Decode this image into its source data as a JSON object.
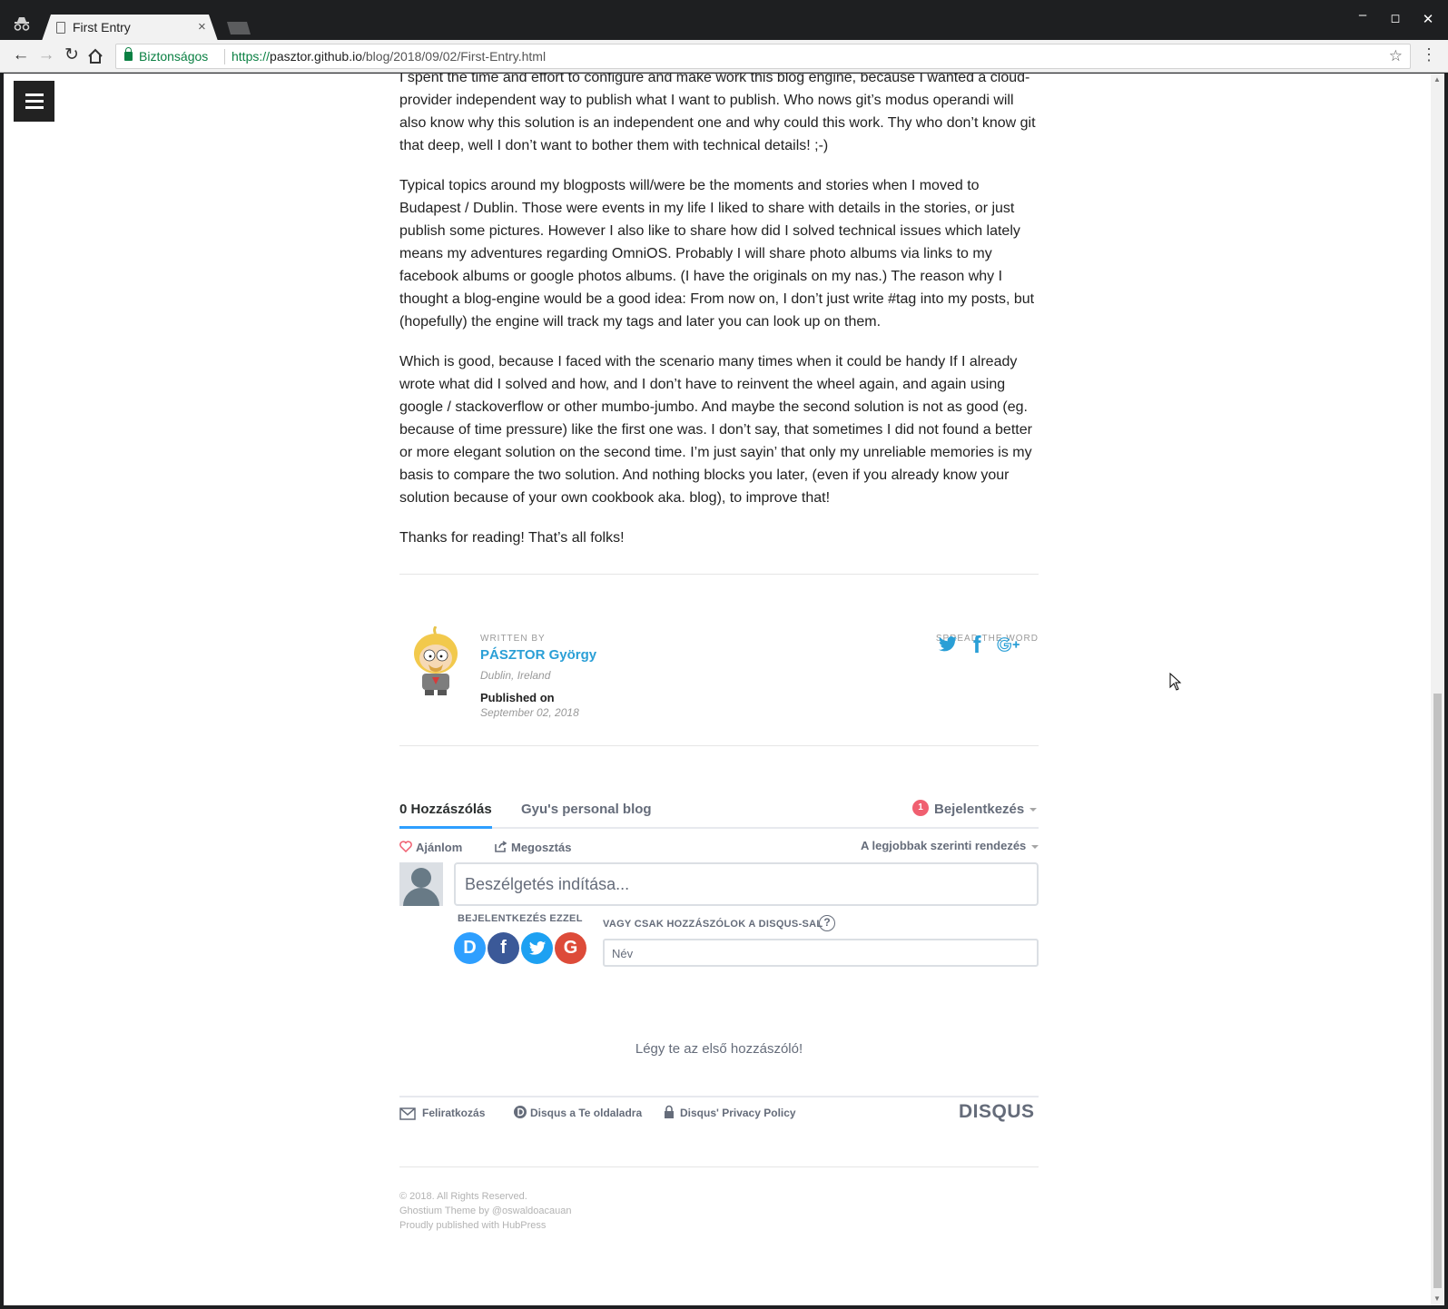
{
  "browser": {
    "tab_title": "First Entry",
    "tab_close": "×",
    "secure_label": "Biztonságos",
    "url_scheme": "https://",
    "url_host": "pasztor.github.io",
    "url_path": "/blog/2018/09/02/First-Entry.html"
  },
  "article": {
    "paragraphs": [
      "I spent the time and effort to configure and make work this blog engine, because I wanted a cloud-provider independent way to publish what I want to publish. Who nows git’s modus operandi will also know why this solution is an independent one and why could this work. Thy who don’t know git that deep, well I don’t want to bother them with technical details! ;-)",
      "Typical topics around my blogposts will/were be the moments and stories when I moved to Budapest / Dublin. Those were events in my life I liked to share with details in the stories, or just publish some pictures. However I also like to share how did I solved technical issues which lately means my adventures regarding OmniOS. Probably I will share photo albums via links to my facebook albums or google photos albums. (I have the originals on my nas.) The reason why I thought a blog-engine would be a good idea: From now on, I don’t just write #tag into my posts, but (hopefully) the engine will track my tags and later you can look up on them.",
      "Which is good, because I faced with the scenario many times when it could be handy If I already wrote what did I solved and how, and I don’t have to reinvent the wheel again, and again using google / stackoverflow or other mumbo-jumbo. And maybe the second solution is not as good (eg. because of time pressure) like the first one was. I don’t say, that sometimes I did not found a better or more elegant solution on the second time. I’m just sayin’ that only my unreliable memories is my basis to compare the two solution. And nothing blocks you later, (even if you already know your solution because of your own cookbook aka. blog), to improve that!",
      "Thanks for reading! That’s all folks!"
    ]
  },
  "author_box": {
    "written_by": "WRITTEN BY",
    "name": "PÁSZTOR György",
    "location": "Dublin, Ireland",
    "published_label": "Published on",
    "published_date": "September 02, 2018",
    "spread_label": "SPREAD THE WORD"
  },
  "disqus": {
    "tab_comments": "0 Hozzászólás",
    "tab_community": "Gyu's personal blog",
    "login_badge": "1",
    "login_label": "Bejelentkezés",
    "recommend": "Ajánlom",
    "share": "Megosztás",
    "sort": "A legjobbak szerinti rendezés",
    "comment_placeholder": "Beszélgetés indítása...",
    "login_with": "BEJELENTKEZÉS EZZEL",
    "guest_label": "VAGY CSAK HOZZÁSZÓLOK A DISQUS-SAL",
    "help": "?",
    "name_placeholder": "Név",
    "first_comment": "Légy te az első hozzászóló!",
    "footer_subscribe": "Feliratkozás",
    "footer_add_disqus": "Disqus a Te oldaladra",
    "footer_privacy": "Disqus' Privacy Policy",
    "logo": "DISQUS",
    "social": [
      "D",
      "f",
      "",
      "G"
    ],
    "colors": {
      "disqus_blue": "#2e9fff",
      "facebook": "#3b5998",
      "twitter": "#1da1f2",
      "google": "#dd4b39",
      "badge": "#f05f70"
    }
  },
  "footer": {
    "copyright": "© 2018. All Rights Reserved.",
    "theme": "Ghostium Theme by @oswaldoacauan",
    "published_with": "Proudly published with HubPress"
  },
  "icons": {
    "share": [
      "twitter-icon",
      "facebook-icon",
      "google-plus-icon"
    ],
    "accent": "#2a9fd6"
  }
}
